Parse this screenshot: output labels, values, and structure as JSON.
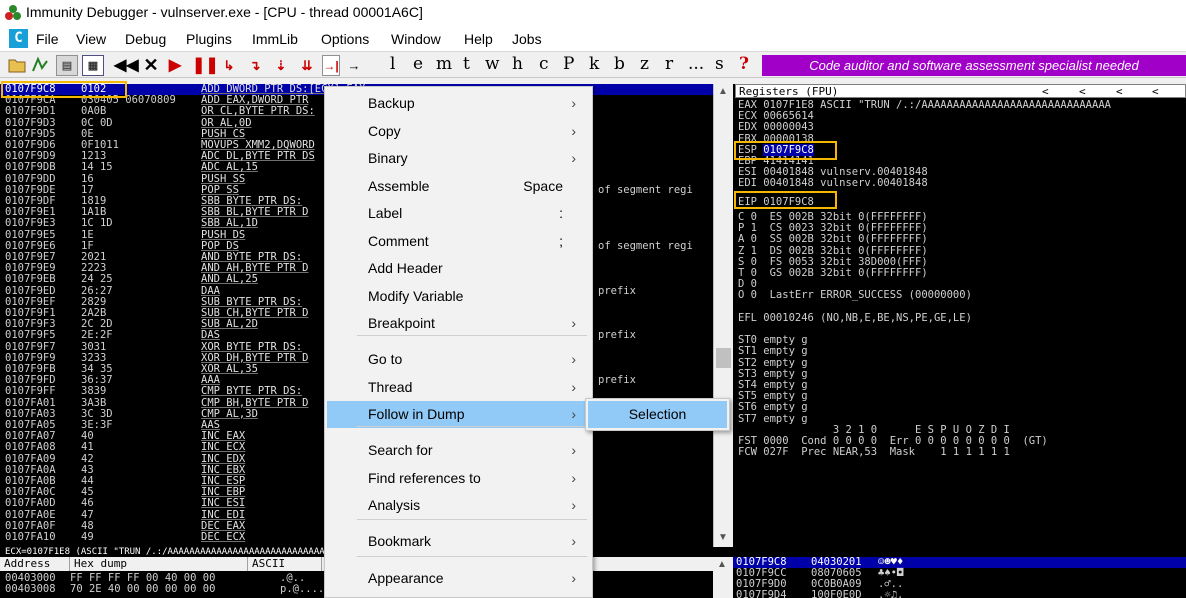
{
  "window": {
    "title": "Immunity Debugger - vulnserver.exe - [CPU - thread 00001A6C]"
  },
  "menu": {
    "items": [
      "File",
      "View",
      "Debug",
      "Plugins",
      "ImmLib",
      "Options",
      "Window",
      "Help",
      "Jobs"
    ]
  },
  "toolbar": {
    "letters": [
      "l",
      "e",
      "m",
      "t",
      "w",
      "h",
      "c",
      "P",
      "k",
      "b",
      "z",
      "r",
      "...",
      "s",
      "?"
    ],
    "banner": "Code auditor and software assessment specialist needed",
    "colors": {
      "banner_bg": "#a000c8",
      "red_buttons": "#cc0000"
    }
  },
  "cpu": {
    "rows": [
      {
        "addr": "0107F9C8",
        "hex": "0102",
        "asm": "ADD DWORD PTR DS:[ECX],EAX",
        "cmt": "",
        "selected": true
      },
      {
        "addr": "0107F9CA",
        "hex": "030405 06070809",
        "asm": "ADD EAX,DWORD PTR",
        "cmt": ""
      },
      {
        "addr": "0107F9D1",
        "hex": "0A0B",
        "asm": "OR CL,BYTE PTR DS:",
        "cmt": ""
      },
      {
        "addr": "0107F9D3",
        "hex": "0C 0D",
        "asm": "OR AL,0D",
        "cmt": ""
      },
      {
        "addr": "0107F9D5",
        "hex": "0E",
        "asm": "PUSH CS",
        "cmt": ""
      },
      {
        "addr": "0107F9D6",
        "hex": "0F1011",
        "asm": "MOVUPS XMM2,DQWORD",
        "cmt": ""
      },
      {
        "addr": "0107F9D9",
        "hex": "1213",
        "asm": "ADC DL,BYTE PTR DS",
        "cmt": ""
      },
      {
        "addr": "0107F9DB",
        "hex": "14 15",
        "asm": "ADC AL,15",
        "cmt": ""
      },
      {
        "addr": "0107F9DD",
        "hex": "16",
        "asm": "PUSH SS",
        "cmt": ""
      },
      {
        "addr": "0107F9DE",
        "hex": "17",
        "asm": "POP SS",
        "cmt": "of segment regi"
      },
      {
        "addr": "0107F9DF",
        "hex": "1819",
        "asm": "SBB BYTE PTR DS:",
        "cmt": ""
      },
      {
        "addr": "0107F9E1",
        "hex": "1A1B",
        "asm": "SBB BL,BYTE PTR D",
        "cmt": ""
      },
      {
        "addr": "0107F9E3",
        "hex": "1C 1D",
        "asm": "SBB AL,1D",
        "cmt": ""
      },
      {
        "addr": "0107F9E5",
        "hex": "1E",
        "asm": "PUSH DS",
        "cmt": ""
      },
      {
        "addr": "0107F9E6",
        "hex": "1F",
        "asm": "POP DS",
        "cmt": "of segment regi"
      },
      {
        "addr": "0107F9E7",
        "hex": "2021",
        "asm": "AND BYTE PTR DS:",
        "cmt": ""
      },
      {
        "addr": "0107F9E9",
        "hex": "2223",
        "asm": "AND AH,BYTE PTR D",
        "cmt": ""
      },
      {
        "addr": "0107F9EB",
        "hex": "24 25",
        "asm": "AND AL,25",
        "cmt": ""
      },
      {
        "addr": "0107F9ED",
        "hex": "26:27",
        "asm": "DAA",
        "cmt": "prefix"
      },
      {
        "addr": "0107F9EF",
        "hex": "2829",
        "asm": "SUB BYTE PTR DS:",
        "cmt": ""
      },
      {
        "addr": "0107F9F1",
        "hex": "2A2B",
        "asm": "SUB CH,BYTE PTR D",
        "cmt": ""
      },
      {
        "addr": "0107F9F3",
        "hex": "2C 2D",
        "asm": "SUB AL,2D",
        "cmt": ""
      },
      {
        "addr": "0107F9F5",
        "hex": "2E:2F",
        "asm": "DAS",
        "cmt": "prefix"
      },
      {
        "addr": "0107F9F7",
        "hex": "3031",
        "asm": "XOR BYTE PTR DS:",
        "cmt": ""
      },
      {
        "addr": "0107F9F9",
        "hex": "3233",
        "asm": "XOR DH,BYTE PTR D",
        "cmt": ""
      },
      {
        "addr": "0107F9FB",
        "hex": "34 35",
        "asm": "XOR AL,35",
        "cmt": ""
      },
      {
        "addr": "0107F9FD",
        "hex": "36:37",
        "asm": "AAA",
        "cmt": "prefix"
      },
      {
        "addr": "0107F9FF",
        "hex": "3839",
        "asm": "CMP BYTE PTR DS:",
        "cmt": ""
      },
      {
        "addr": "0107FA01",
        "hex": "3A3B",
        "asm": "CMP BH,BYTE PTR D",
        "cmt": ""
      },
      {
        "addr": "0107FA03",
        "hex": "3C 3D",
        "asm": "CMP AL,3D",
        "cmt": ""
      },
      {
        "addr": "0107FA05",
        "hex": "3E:3F",
        "asm": "AAS",
        "cmt": ""
      },
      {
        "addr": "0107FA07",
        "hex": "40",
        "asm": "INC EAX",
        "cmt": ""
      },
      {
        "addr": "0107FA08",
        "hex": "41",
        "asm": "INC ECX",
        "cmt": ""
      },
      {
        "addr": "0107FA09",
        "hex": "42",
        "asm": "INC EDX",
        "cmt": ""
      },
      {
        "addr": "0107FA0A",
        "hex": "43",
        "asm": "INC EBX",
        "cmt": ""
      },
      {
        "addr": "0107FA0B",
        "hex": "44",
        "asm": "INC ESP",
        "cmt": ""
      },
      {
        "addr": "0107FA0C",
        "hex": "45",
        "asm": "INC EBP",
        "cmt": ""
      },
      {
        "addr": "0107FA0D",
        "hex": "46",
        "asm": "INC ESI",
        "cmt": ""
      },
      {
        "addr": "0107FA0E",
        "hex": "47",
        "asm": "INC EDI",
        "cmt": ""
      },
      {
        "addr": "0107FA0F",
        "hex": "48",
        "asm": "DEC EAX",
        "cmt": ""
      },
      {
        "addr": "0107FA10",
        "hex": "49",
        "asm": "DEC ECX",
        "cmt": ""
      }
    ]
  },
  "info_line": "ECX=0107F1E8 (ASCII \"TRUN /.:/AAAAAAAAAAAAAAAAAAAAAAAAAAAAAAAAAAAAAAAAAAAAAAAAAAAAA",
  "dump": {
    "headers": [
      "Address",
      "Hex dump",
      "ASCII"
    ],
    "rows": [
      {
        "addr": "00403000",
        "hex": "FF FF FF FF 00 40 00 00",
        "ascii": ".@.."
      },
      {
        "addr": "00403008",
        "hex": "70 2E 40 00 00 00 00 00",
        "ascii": "p.@....."
      }
    ]
  },
  "registers": {
    "title": "Registers (FPU)",
    "lines": [
      "EAX 0107F1E8 ASCII \"TRUN /.:/AAAAAAAAAAAAAAAAAAAAAAAAAAAAAA",
      "ECX 00665614",
      "EDX 00000043",
      "EBX 00000138",
      "",
      "EBP 41414141",
      "ESI 00401848 vulnserv.00401848",
      "EDI 00401848 vulnserv.00401848",
      "",
      "",
      "C 0  ES 002B 32bit 0(FFFFFFFF)",
      "P 1  CS 0023 32bit 0(FFFFFFFF)",
      "A 0  SS 002B 32bit 0(FFFFFFFF)",
      "Z 1  DS 002B 32bit 0(FFFFFFFF)",
      "S 0  FS 0053 32bit 38D000(FFF)",
      "T 0  GS 002B 32bit 0(FFFFFFFF)",
      "D 0",
      "O 0  LastErr ERROR_SUCCESS (00000000)",
      "",
      "EFL 00010246 (NO,NB,E,BE,NS,PE,GE,LE)",
      "",
      "ST0 empty g",
      "ST1 empty g",
      "ST2 empty g",
      "ST3 empty g",
      "ST4 empty g",
      "ST5 empty g",
      "ST6 empty g",
      "ST7 empty g",
      "               3 2 1 0      E S P U O Z D I",
      "FST 0000  Cond 0 0 0 0  Err 0 0 0 0 0 0 0 0  (GT)",
      "FCW 027F  Prec NEAR,53  Mask    1 1 1 1 1 1"
    ],
    "esp_label": "ESP 0107F9C8",
    "eip_label": "EIP 0107F9C8"
  },
  "stack": {
    "rows": [
      {
        "addr": "0107F9C8",
        "val": "04030201",
        "asc": "☺☻♥♦",
        "selected": true
      },
      {
        "addr": "0107F9CC",
        "val": "08070605",
        "asc": "♣♠•◘"
      },
      {
        "addr": "0107F9D0",
        "val": "0C0B0A09",
        "asc": ".♂.."
      },
      {
        "addr": "0107F9D4",
        "val": "100F0E0D",
        "asc": ".☼♫."
      }
    ]
  },
  "context_menu": {
    "items": [
      {
        "label": "Backup",
        "shortcut": "",
        "submenu": true
      },
      {
        "label": "Copy",
        "shortcut": "",
        "submenu": true
      },
      {
        "label": "Binary",
        "shortcut": "",
        "submenu": true
      },
      {
        "label": "Assemble",
        "shortcut": "Space",
        "submenu": false
      },
      {
        "label": "Label",
        "shortcut": ":",
        "submenu": false
      },
      {
        "label": "Comment",
        "shortcut": ";",
        "submenu": false
      },
      {
        "label": "Add Header",
        "shortcut": "",
        "submenu": false
      },
      {
        "label": "Modify Variable",
        "shortcut": "",
        "submenu": false
      },
      {
        "label": "Breakpoint",
        "shortcut": "",
        "submenu": true
      },
      {
        "label": "Go to",
        "shortcut": "",
        "submenu": true
      },
      {
        "label": "Thread",
        "shortcut": "",
        "submenu": true
      },
      {
        "label": "Follow in Dump",
        "shortcut": "",
        "submenu": true,
        "highlighted": true
      },
      {
        "label": "Search for",
        "shortcut": "",
        "submenu": true
      },
      {
        "label": "Find references to",
        "shortcut": "",
        "submenu": true
      },
      {
        "label": "Analysis",
        "shortcut": "",
        "submenu": true
      },
      {
        "label": "Bookmark",
        "shortcut": "",
        "submenu": true
      },
      {
        "label": "Appearance",
        "shortcut": "",
        "submenu": true
      }
    ],
    "submenu_item": "Selection",
    "highlight_color": "#91c9f7"
  },
  "annotation_color": "#f5b800"
}
